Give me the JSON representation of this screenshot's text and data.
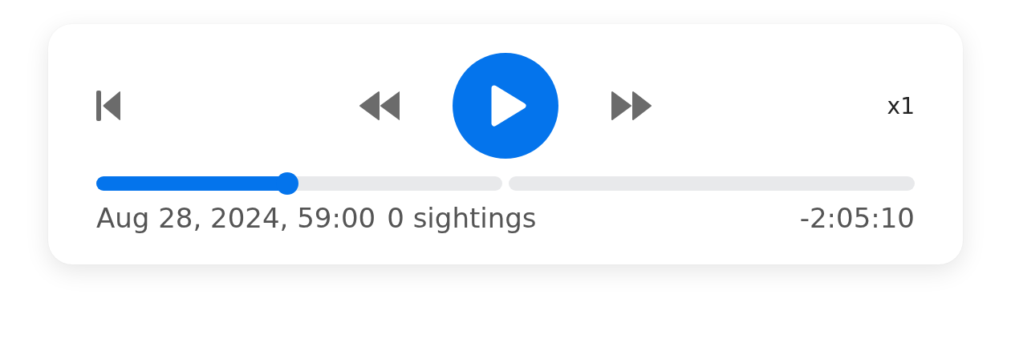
{
  "player": {
    "playing": false,
    "speed": "x1",
    "timeline": [
      {
        "kind": "progress",
        "level": 0.47
      },
      {
        "kind": "plain"
      }
    ],
    "timestamp": "Aug 28, 2024, 59:00",
    "sightings": "0 sightings",
    "remaining": "-2:05:10"
  }
}
